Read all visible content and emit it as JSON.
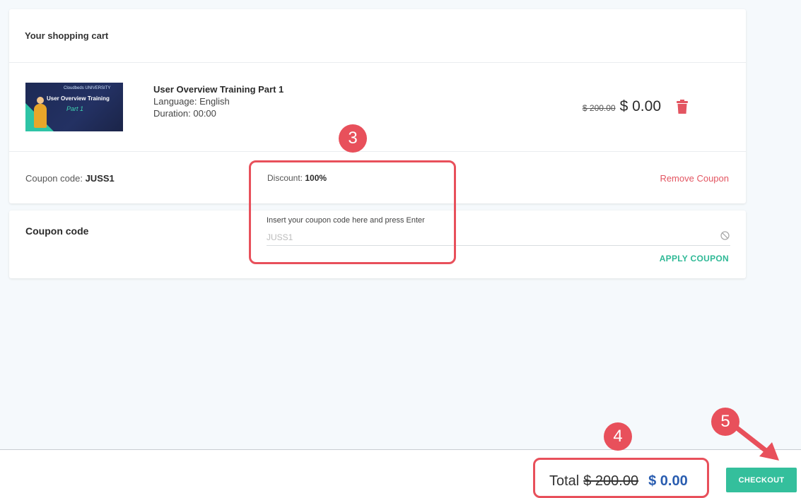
{
  "cart": {
    "title": "Your shopping cart",
    "item": {
      "thumbnail": {
        "logo": "Cloudbeds UNIVERSITY",
        "title": "User Overview Training",
        "subtitle": "Part 1"
      },
      "name": "User Overview Training Part 1",
      "language": "Language: English",
      "duration": "Duration: 00:00",
      "old_price": "$ 200.00",
      "price": "$ 0.00",
      "delete_icon": "trash-icon"
    },
    "coupon": {
      "label": "Coupon code: ",
      "value": "JUSS1",
      "discount_label": "Discount: ",
      "discount_value": "100%",
      "remove_label": "Remove Coupon"
    }
  },
  "coupon_form": {
    "title": "Coupon code",
    "field_label": "Insert your coupon code here and press Enter",
    "placeholder": "JUSS1",
    "apply_label": "APPLY COUPON",
    "clear_icon": "block-icon"
  },
  "footer": {
    "total_label": "Total",
    "old_total": "$ 200.00",
    "total": "$ 0.00",
    "checkout_label": "CHECKOUT"
  },
  "annotations": {
    "step3": "3",
    "step4": "4",
    "step5": "5"
  },
  "colors": {
    "accent": "#34bf9c",
    "danger": "#e35561",
    "annotation": "#e8505b",
    "total": "#2a5db0"
  }
}
